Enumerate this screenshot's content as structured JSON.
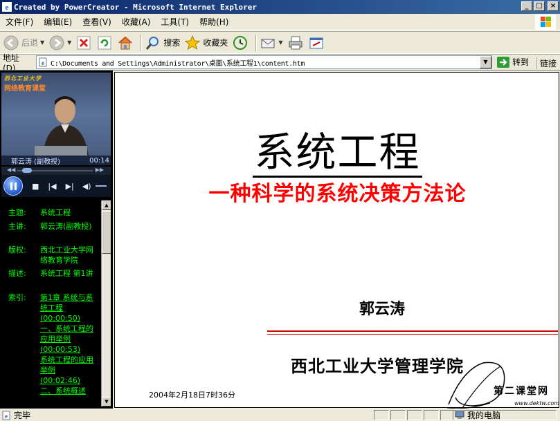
{
  "window": {
    "title": "Created by PowerCreator - Microsoft Internet Explorer",
    "buttons": [
      "_",
      "□",
      "×"
    ]
  },
  "menubar": {
    "items": [
      "文件(F)",
      "编辑(E)",
      "查看(V)",
      "收藏(A)",
      "工具(T)",
      "帮助(H)"
    ]
  },
  "toolbar": {
    "back_label": "后退",
    "search_label": "搜索",
    "favorites_label": "收藏夹"
  },
  "address": {
    "label": "地址(D)",
    "url": "C:\\Documents and Settings\\Administrator\\桌面\\系统工程1\\content.htm",
    "go_label": "转到",
    "links_label": "链接"
  },
  "player": {
    "brand_line1": "西北工业大学",
    "brand_line2": "网络教育课堂",
    "speaker_caption": "郭云涛 (副教授)",
    "elapsed": "00:14"
  },
  "info": {
    "topic_key": "主题:",
    "topic_value": "系统工程",
    "speaker_key": "主讲:",
    "speaker_value": "郭云涛(副教授)",
    "copyright_key": "版权:",
    "copyright_value": "西北工业大学网络教育学院",
    "desc_key": "描述:",
    "desc_value": "系统工程 第1讲",
    "index_key": "索引:",
    "index_items": [
      {
        "text": "第1章 系统与系统工程",
        "time": "(00:00:50)"
      },
      {
        "text": "一、系统工程的应用举例",
        "time": "(00:00:53)"
      },
      {
        "text": "系统工程的应用举例",
        "time": "(00:02:46)"
      },
      {
        "text": "二、系统概述",
        "time": ""
      }
    ]
  },
  "slide": {
    "title": "系统工程",
    "subtitle": "一种科学的系统决策方法论",
    "author": "郭云涛",
    "institution": "西北工业大学管理学院",
    "date": "2004年2月18日7时36分",
    "watermark_text": "第二课堂网",
    "watermark_url": "www.dektw.com"
  },
  "status": {
    "text": "完毕",
    "zone": "我的电脑"
  },
  "colors": {
    "title_bar": "#0a246a",
    "slide_subtitle": "#ff0000",
    "sidebar_text": "#00ff00",
    "divider_lines": "#cc0000"
  }
}
